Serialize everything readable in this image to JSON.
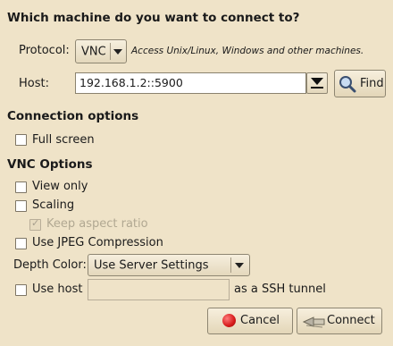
{
  "title": "Which machine do you want to connect to?",
  "protocol": {
    "label": "Protocol:",
    "value": "VNC",
    "description": "Access Unix/Linux, Windows and other machines."
  },
  "host": {
    "label": "Host:",
    "value": "192.168.1.2::5900",
    "find_label": "Find"
  },
  "connection_options": {
    "heading": "Connection options",
    "full_screen": {
      "label": "Full screen",
      "checked": false
    }
  },
  "vnc_options": {
    "heading": "VNC Options",
    "view_only": {
      "label": "View only",
      "checked": false
    },
    "scaling": {
      "label": "Scaling",
      "checked": false
    },
    "keep_aspect": {
      "label": "Keep aspect ratio",
      "checked": true,
      "enabled": false
    },
    "jpeg": {
      "label": "Use JPEG Compression",
      "checked": false
    },
    "depth": {
      "label": "Depth Color:",
      "value": "Use Server Settings"
    },
    "ssh": {
      "label_before": "Use host",
      "label_after": "as a SSH tunnel",
      "host_value": "",
      "checked": false
    }
  },
  "buttons": {
    "cancel": "Cancel",
    "connect": "Connect"
  },
  "colors": {
    "background": "#efe3c8",
    "cancel_icon": "#d61a1a"
  }
}
